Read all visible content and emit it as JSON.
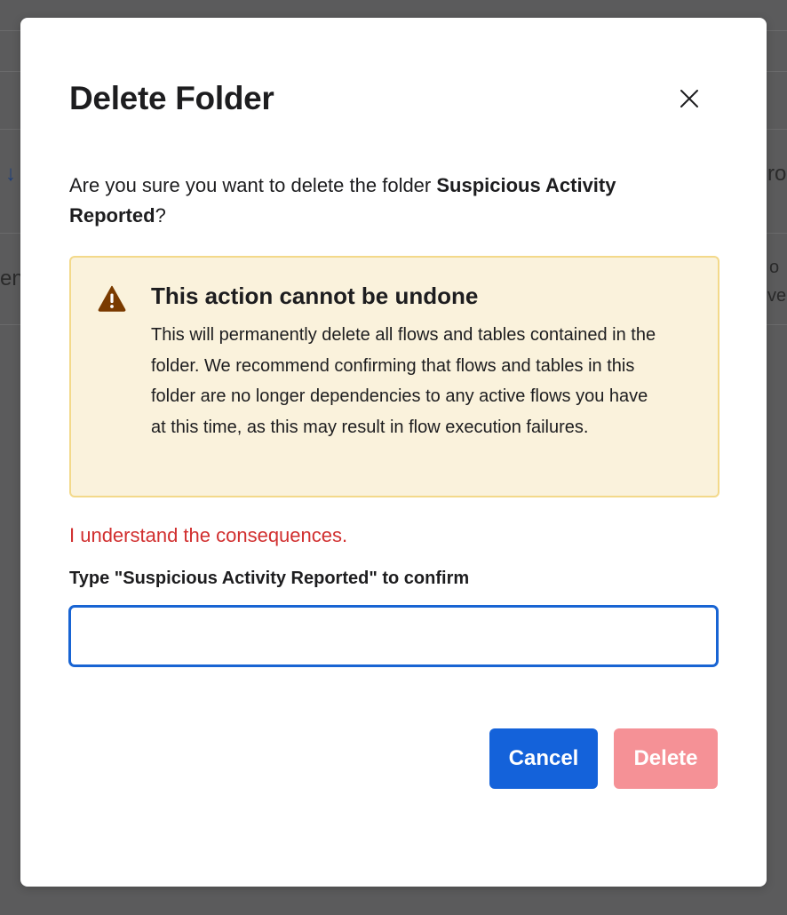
{
  "dialog": {
    "title": "Delete Folder",
    "intro_prefix": "Are you sure you want to delete the folder ",
    "folder_name": "Suspicious Activity Reported",
    "intro_suffix": "?",
    "warning": {
      "title": "This action cannot be undone",
      "body": "This will permanently delete all flows and tables contained in the folder. We recommend confirming that flows and tables in this folder are no longer dependencies to any active flows you have at this time, as this may result in flow execution failures.",
      "icon": "warning-triangle-icon"
    },
    "consequence_text": "I understand the consequences.",
    "confirm_label": "Type \"Suspicious Activity Reported\" to confirm",
    "confirm_input": {
      "value": "",
      "placeholder": ""
    },
    "buttons": {
      "cancel": "Cancel",
      "delete": "Delete"
    }
  },
  "background_fragments": {
    "arrow": "↓",
    "right_top": "ro",
    "left_mid": "en",
    "right_mid_top": "o",
    "right_mid_bottom": "ve"
  },
  "colors": {
    "primary": "#1462da",
    "danger_disabled": "#f59196",
    "danger_text": "#d12f2f",
    "warning_bg": "#faf2dc",
    "warning_border": "#f3d98a",
    "warning_icon": "#7a3b00",
    "overlay": "#5b5b5c"
  }
}
